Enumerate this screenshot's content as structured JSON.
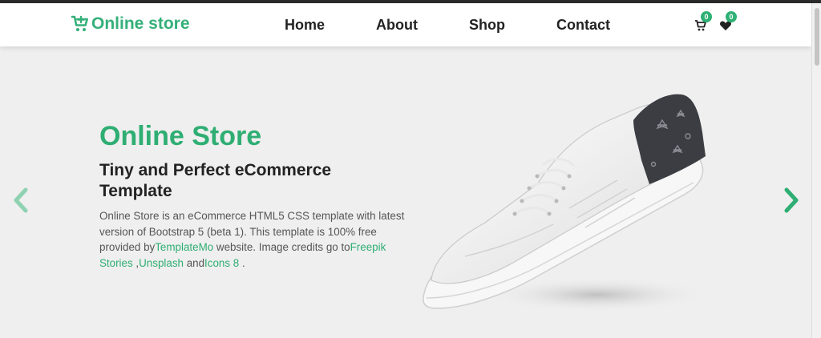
{
  "brand": {
    "name": "Online store",
    "icon": "cart-plus-icon",
    "color": "#35b07a"
  },
  "nav": {
    "links": [
      "Home",
      "About",
      "Shop",
      "Contact"
    ],
    "cart": {
      "icon": "cart-icon",
      "count": "0"
    },
    "wishlist": {
      "icon": "heart-icon",
      "count": "0"
    }
  },
  "hero": {
    "title": "Online Store",
    "subtitle": "Tiny and Perfect eCommerce Template",
    "description_parts": {
      "p1": "Online Store is an eCommerce HTML5 CSS template with latest version of Bootstrap 5 (beta 1). This template is 100% free provided by",
      "link1": "TemplateMo",
      "p2": " website. Image credits go to",
      "link2": "Freepik Stories",
      "p3": " ,",
      "link3": "Unsplash",
      "p4": " and",
      "link4": "Icons 8",
      "p5": " ."
    },
    "image": "sneaker-image",
    "prev_icon": "chevron-left-icon",
    "next_icon": "chevron-right-icon"
  },
  "colors": {
    "accent": "#2fae73",
    "background": "#efefef",
    "text": "#222222"
  }
}
